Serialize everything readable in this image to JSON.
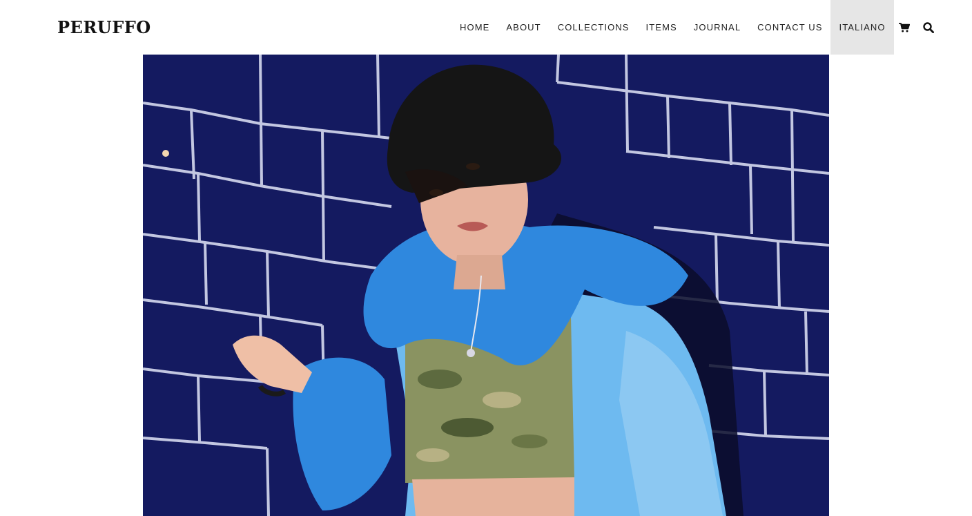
{
  "brand": {
    "logo_text": "PERUFFO"
  },
  "nav": {
    "items": [
      {
        "label": "HOME"
      },
      {
        "label": "ABOUT"
      },
      {
        "label": "COLLECTIONS"
      },
      {
        "label": "ITEMS"
      },
      {
        "label": "JOURNAL"
      },
      {
        "label": "CONTACT US"
      },
      {
        "label": "ITALIANO",
        "active": true
      }
    ],
    "icons": [
      "cart-icon",
      "search-icon"
    ]
  },
  "hero": {
    "image": "fashion-photo-blue-fur-jacket",
    "colors": {
      "tile": "#141a60",
      "grout": "#d8dcf0",
      "jacket": "#5cb2ec",
      "fur": "#2e86de",
      "hat": "#141414",
      "skin": "#e7b39e",
      "camo": "#8c9463"
    }
  }
}
